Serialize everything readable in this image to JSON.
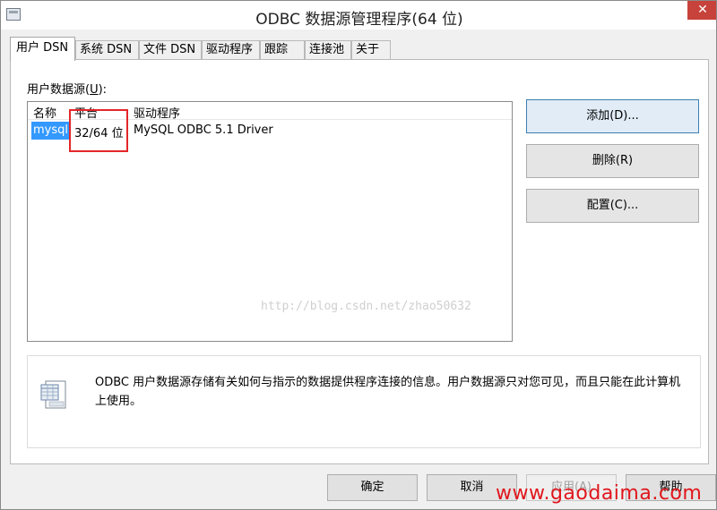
{
  "window": {
    "title": "ODBC 数据源管理程序(64 位)",
    "close_symbol": "✕"
  },
  "tabs": [
    {
      "label": "用户 DSN",
      "active": true
    },
    {
      "label": "系统 DSN"
    },
    {
      "label": "文件 DSN"
    },
    {
      "label": "驱动程序"
    },
    {
      "label": "跟踪"
    },
    {
      "label": "连接池"
    },
    {
      "label": "关于"
    }
  ],
  "user_dsn": {
    "label_prefix": "用户数据源(",
    "label_accel": "U",
    "label_suffix": "):",
    "columns": [
      "名称",
      "平台",
      "驱动程序"
    ],
    "rows": [
      {
        "name": "mysql",
        "platform": "32/64 位",
        "driver": "MySQL ODBC 5.1 Driver"
      }
    ],
    "watermark": "http://blog.csdn.net/zhao50632"
  },
  "buttons": {
    "add_label": "添加(D)...",
    "remove_label": "删除(R)",
    "configure_label": "配置(C)..."
  },
  "info": {
    "text": "ODBC 用户数据源存储有关如何与指示的数据提供程序连接的信息。用户数据源只对您可见，而且只能在此计算机上使用。"
  },
  "footer": {
    "ok_label": "确定",
    "cancel_label": "取消",
    "apply_label": "应用(A)",
    "help_label": "帮助"
  },
  "site_watermark": "www.gaodaima.com",
  "colors": {
    "selection": "#3399ff",
    "highlight_box": "#e3262a",
    "close_button": "#c7423a",
    "site_watermark": "#e0161c"
  }
}
